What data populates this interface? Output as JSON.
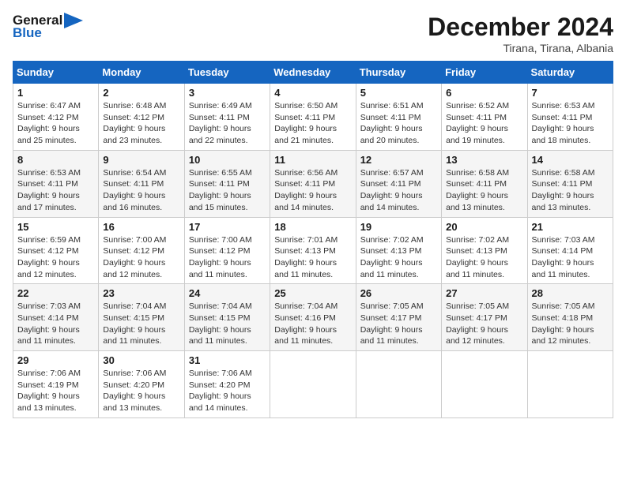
{
  "header": {
    "logo_line1": "General",
    "logo_line2": "Blue",
    "month_title": "December 2024",
    "subtitle": "Tirana, Tirana, Albania"
  },
  "days_of_week": [
    "Sunday",
    "Monday",
    "Tuesday",
    "Wednesday",
    "Thursday",
    "Friday",
    "Saturday"
  ],
  "weeks": [
    [
      {
        "day": "1",
        "sunrise": "Sunrise: 6:47 AM",
        "sunset": "Sunset: 4:12 PM",
        "daylight": "Daylight: 9 hours and 25 minutes."
      },
      {
        "day": "2",
        "sunrise": "Sunrise: 6:48 AM",
        "sunset": "Sunset: 4:12 PM",
        "daylight": "Daylight: 9 hours and 23 minutes."
      },
      {
        "day": "3",
        "sunrise": "Sunrise: 6:49 AM",
        "sunset": "Sunset: 4:11 PM",
        "daylight": "Daylight: 9 hours and 22 minutes."
      },
      {
        "day": "4",
        "sunrise": "Sunrise: 6:50 AM",
        "sunset": "Sunset: 4:11 PM",
        "daylight": "Daylight: 9 hours and 21 minutes."
      },
      {
        "day": "5",
        "sunrise": "Sunrise: 6:51 AM",
        "sunset": "Sunset: 4:11 PM",
        "daylight": "Daylight: 9 hours and 20 minutes."
      },
      {
        "day": "6",
        "sunrise": "Sunrise: 6:52 AM",
        "sunset": "Sunset: 4:11 PM",
        "daylight": "Daylight: 9 hours and 19 minutes."
      },
      {
        "day": "7",
        "sunrise": "Sunrise: 6:53 AM",
        "sunset": "Sunset: 4:11 PM",
        "daylight": "Daylight: 9 hours and 18 minutes."
      }
    ],
    [
      {
        "day": "8",
        "sunrise": "Sunrise: 6:53 AM",
        "sunset": "Sunset: 4:11 PM",
        "daylight": "Daylight: 9 hours and 17 minutes."
      },
      {
        "day": "9",
        "sunrise": "Sunrise: 6:54 AM",
        "sunset": "Sunset: 4:11 PM",
        "daylight": "Daylight: 9 hours and 16 minutes."
      },
      {
        "day": "10",
        "sunrise": "Sunrise: 6:55 AM",
        "sunset": "Sunset: 4:11 PM",
        "daylight": "Daylight: 9 hours and 15 minutes."
      },
      {
        "day": "11",
        "sunrise": "Sunrise: 6:56 AM",
        "sunset": "Sunset: 4:11 PM",
        "daylight": "Daylight: 9 hours and 14 minutes."
      },
      {
        "day": "12",
        "sunrise": "Sunrise: 6:57 AM",
        "sunset": "Sunset: 4:11 PM",
        "daylight": "Daylight: 9 hours and 14 minutes."
      },
      {
        "day": "13",
        "sunrise": "Sunrise: 6:58 AM",
        "sunset": "Sunset: 4:11 PM",
        "daylight": "Daylight: 9 hours and 13 minutes."
      },
      {
        "day": "14",
        "sunrise": "Sunrise: 6:58 AM",
        "sunset": "Sunset: 4:11 PM",
        "daylight": "Daylight: 9 hours and 13 minutes."
      }
    ],
    [
      {
        "day": "15",
        "sunrise": "Sunrise: 6:59 AM",
        "sunset": "Sunset: 4:12 PM",
        "daylight": "Daylight: 9 hours and 12 minutes."
      },
      {
        "day": "16",
        "sunrise": "Sunrise: 7:00 AM",
        "sunset": "Sunset: 4:12 PM",
        "daylight": "Daylight: 9 hours and 12 minutes."
      },
      {
        "day": "17",
        "sunrise": "Sunrise: 7:00 AM",
        "sunset": "Sunset: 4:12 PM",
        "daylight": "Daylight: 9 hours and 11 minutes."
      },
      {
        "day": "18",
        "sunrise": "Sunrise: 7:01 AM",
        "sunset": "Sunset: 4:13 PM",
        "daylight": "Daylight: 9 hours and 11 minutes."
      },
      {
        "day": "19",
        "sunrise": "Sunrise: 7:02 AM",
        "sunset": "Sunset: 4:13 PM",
        "daylight": "Daylight: 9 hours and 11 minutes."
      },
      {
        "day": "20",
        "sunrise": "Sunrise: 7:02 AM",
        "sunset": "Sunset: 4:13 PM",
        "daylight": "Daylight: 9 hours and 11 minutes."
      },
      {
        "day": "21",
        "sunrise": "Sunrise: 7:03 AM",
        "sunset": "Sunset: 4:14 PM",
        "daylight": "Daylight: 9 hours and 11 minutes."
      }
    ],
    [
      {
        "day": "22",
        "sunrise": "Sunrise: 7:03 AM",
        "sunset": "Sunset: 4:14 PM",
        "daylight": "Daylight: 9 hours and 11 minutes."
      },
      {
        "day": "23",
        "sunrise": "Sunrise: 7:04 AM",
        "sunset": "Sunset: 4:15 PM",
        "daylight": "Daylight: 9 hours and 11 minutes."
      },
      {
        "day": "24",
        "sunrise": "Sunrise: 7:04 AM",
        "sunset": "Sunset: 4:15 PM",
        "daylight": "Daylight: 9 hours and 11 minutes."
      },
      {
        "day": "25",
        "sunrise": "Sunrise: 7:04 AM",
        "sunset": "Sunset: 4:16 PM",
        "daylight": "Daylight: 9 hours and 11 minutes."
      },
      {
        "day": "26",
        "sunrise": "Sunrise: 7:05 AM",
        "sunset": "Sunset: 4:17 PM",
        "daylight": "Daylight: 9 hours and 11 minutes."
      },
      {
        "day": "27",
        "sunrise": "Sunrise: 7:05 AM",
        "sunset": "Sunset: 4:17 PM",
        "daylight": "Daylight: 9 hours and 12 minutes."
      },
      {
        "day": "28",
        "sunrise": "Sunrise: 7:05 AM",
        "sunset": "Sunset: 4:18 PM",
        "daylight": "Daylight: 9 hours and 12 minutes."
      }
    ],
    [
      {
        "day": "29",
        "sunrise": "Sunrise: 7:06 AM",
        "sunset": "Sunset: 4:19 PM",
        "daylight": "Daylight: 9 hours and 13 minutes."
      },
      {
        "day": "30",
        "sunrise": "Sunrise: 7:06 AM",
        "sunset": "Sunset: 4:20 PM",
        "daylight": "Daylight: 9 hours and 13 minutes."
      },
      {
        "day": "31",
        "sunrise": "Sunrise: 7:06 AM",
        "sunset": "Sunset: 4:20 PM",
        "daylight": "Daylight: 9 hours and 14 minutes."
      },
      null,
      null,
      null,
      null
    ]
  ]
}
